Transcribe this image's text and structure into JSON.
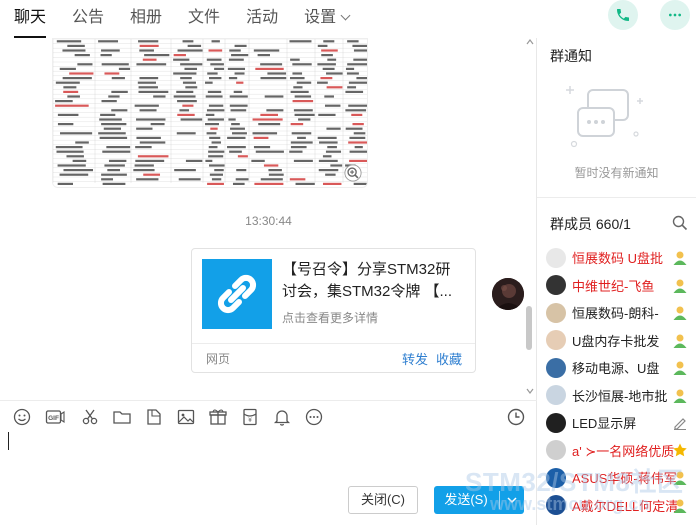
{
  "tabs": [
    {
      "label": "聊天",
      "active": true
    },
    {
      "label": "公告",
      "active": false
    },
    {
      "label": "相册",
      "active": false
    },
    {
      "label": "文件",
      "active": false
    },
    {
      "label": "活动",
      "active": false
    },
    {
      "label": "设置",
      "active": false
    }
  ],
  "header_actions": {
    "call_icon": "phone-icon",
    "more_icon": "more-icon",
    "accent": "#12b886"
  },
  "chat": {
    "image_message_icon": "zoom-in-icon",
    "timestamp": "13:30:44",
    "share_card": {
      "title_line1": "【号召令】分享STM32研",
      "title_line2": "讨会，集STM32令牌 【...",
      "description": "点击查看更多详情",
      "source": "网页",
      "forward": "转发",
      "favorite": "收藏",
      "thumb_color": "#12a0e8"
    }
  },
  "toolbar": {
    "icons": [
      "emoji-icon",
      "gif-icon",
      "scissors-icon",
      "folder-icon",
      "sticker-icon",
      "image-icon",
      "gift-box-icon",
      "red-packet-icon",
      "bell-icon",
      "more-circle-icon"
    ],
    "history_icon": "clock-icon"
  },
  "input": {
    "value": ""
  },
  "buttons": {
    "close": "关闭(C)",
    "send": "发送(S)"
  },
  "right_panel": {
    "notice_title": "群通知",
    "notice_empty": "暂时没有新通知",
    "members_title": "群成员 660/1",
    "members": [
      {
        "name": "恒展数码 U盘批",
        "color": "#e02020",
        "badge": "admin-icon"
      },
      {
        "name": "中维世纪-飞鱼",
        "color": "#e02020",
        "badge": "admin-icon"
      },
      {
        "name": "恒展数码-朗科-",
        "color": "#222222",
        "badge": "admin-icon"
      },
      {
        "name": "U盘内存卡批发",
        "color": "#222222",
        "badge": "admin-icon"
      },
      {
        "name": "移动电源、U盘",
        "color": "#222222",
        "badge": "admin-icon"
      },
      {
        "name": "长沙恒展-地市批",
        "color": "#222222",
        "badge": "admin-icon"
      },
      {
        "name": "LED显示屏",
        "color": "#222222",
        "badge": "edit-icon"
      },
      {
        "name": "a' ≻一名网络优质",
        "color": "#e02020",
        "badge": "star-icon"
      },
      {
        "name": "ASUS华硕-蒋伟军",
        "color": "#e02020",
        "badge": "admin-icon"
      },
      {
        "name": "A戴尔DELL何定清",
        "color": "#e02020",
        "badge": "admin-icon"
      }
    ]
  },
  "watermark": {
    "line1": "STM32/STM8社区",
    "line2": "www.stmcu.org.cn"
  }
}
